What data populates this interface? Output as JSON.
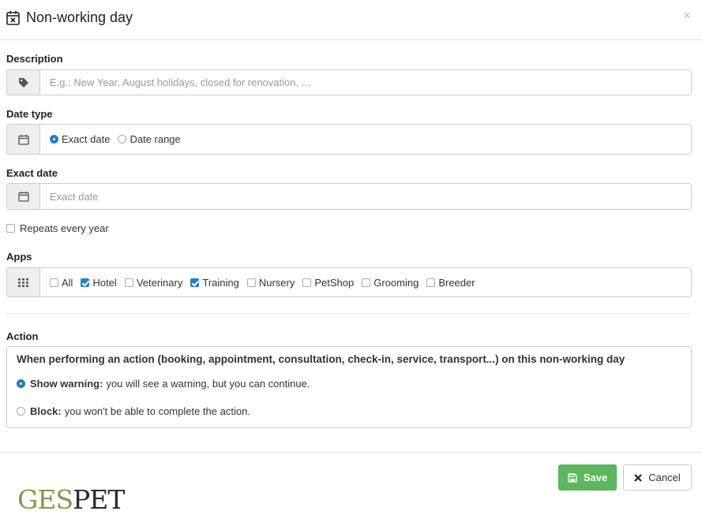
{
  "modal": {
    "title": "Non-working day",
    "title_icon": "calendar-x-icon",
    "close_label": "×"
  },
  "description": {
    "label": "Description",
    "placeholder": "E.g.: New Year, August holidays, closed for renovation, ...",
    "value": "",
    "icon": "tag-icon"
  },
  "date_type": {
    "label": "Date type",
    "icon": "calendar-icon",
    "options": [
      {
        "label": "Exact date",
        "selected": true
      },
      {
        "label": "Date range",
        "selected": false
      }
    ]
  },
  "exact_date": {
    "label": "Exact date",
    "placeholder": "Exact date",
    "value": "",
    "icon": "calendar-icon"
  },
  "repeats": {
    "label": "Repeats every year",
    "checked": false
  },
  "apps": {
    "label": "Apps",
    "icon": "grid-icon",
    "items": [
      {
        "label": "All",
        "checked": false
      },
      {
        "label": "Hotel",
        "checked": true
      },
      {
        "label": "Veterinary",
        "checked": false
      },
      {
        "label": "Training",
        "checked": true
      },
      {
        "label": "Nursery",
        "checked": false
      },
      {
        "label": "PetShop",
        "checked": false
      },
      {
        "label": "Grooming",
        "checked": false
      },
      {
        "label": "Breeder",
        "checked": false
      }
    ]
  },
  "action": {
    "label": "Action",
    "intro": "When performing an action (booking, appointment, consultation, check-in, service, transport...) on this non-working day",
    "options": [
      {
        "title": "Show warning:",
        "desc": "you will see a warning, but you can continue.",
        "selected": true
      },
      {
        "title": "Block:",
        "desc": "you won't be able to complete the action.",
        "selected": false
      }
    ]
  },
  "footer": {
    "logo_part1": "GES",
    "logo_part2": "PET",
    "save_label": "Save",
    "cancel_label": "Cancel"
  },
  "colors": {
    "accent": "#1c7ed6",
    "save": "#5cb85c",
    "logo_green": "#8a9447"
  }
}
